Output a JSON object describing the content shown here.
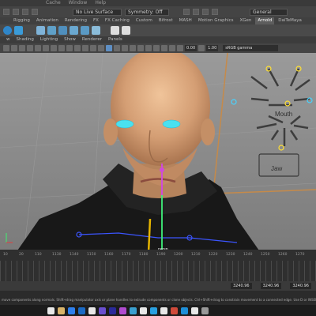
{
  "menubar": {
    "items": [
      "",
      "",
      "",
      "",
      "",
      "Cache",
      "Window",
      "Help"
    ]
  },
  "statusline": {
    "live_surface": "No Live Surface",
    "symmetry": "Symmetry: Off",
    "workspace": "General"
  },
  "shelf_tabs": [
    {
      "label": "Rigging"
    },
    {
      "label": "Animation"
    },
    {
      "label": "Rendering"
    },
    {
      "label": "FX"
    },
    {
      "label": "FX Caching"
    },
    {
      "label": "Custom"
    },
    {
      "label": "Bifrost"
    },
    {
      "label": "MASH"
    },
    {
      "label": "Motion Graphics"
    },
    {
      "label": "XGen"
    },
    {
      "label": "Arnold"
    },
    {
      "label": "DaiTeMaya"
    }
  ],
  "panel_menu": [
    "w",
    "Shading",
    "Lighting",
    "Show",
    "Renderer",
    "Panels"
  ],
  "panel_toolbar": {
    "val1": "0.00",
    "val2": "1.00",
    "color_space": "sRGB gamma"
  },
  "face_gui": {
    "mouth_label": "Mouth",
    "jaw_label": "Jaw"
  },
  "viewport": {
    "persp_label": "persp"
  },
  "timeline": {
    "ticks": [
      "10",
      "20",
      "110",
      "1130",
      "1140",
      "1150",
      "1160",
      "1170",
      "1180",
      "1190",
      "1200",
      "1210",
      "1220",
      "1230",
      "1240",
      "1250",
      "1260",
      "1270"
    ]
  },
  "range": {
    "start": "3240.96",
    "mid": "3240.96",
    "end": "3240.96"
  },
  "help_line": "move components along normals. Shift+drag manipulator axis or plane handles to extrude components or clone objects. Ctrl+Shift+drag to constrain movement to a connected edge. Use D or INSERT to change the pivot position and axis orientation"
}
